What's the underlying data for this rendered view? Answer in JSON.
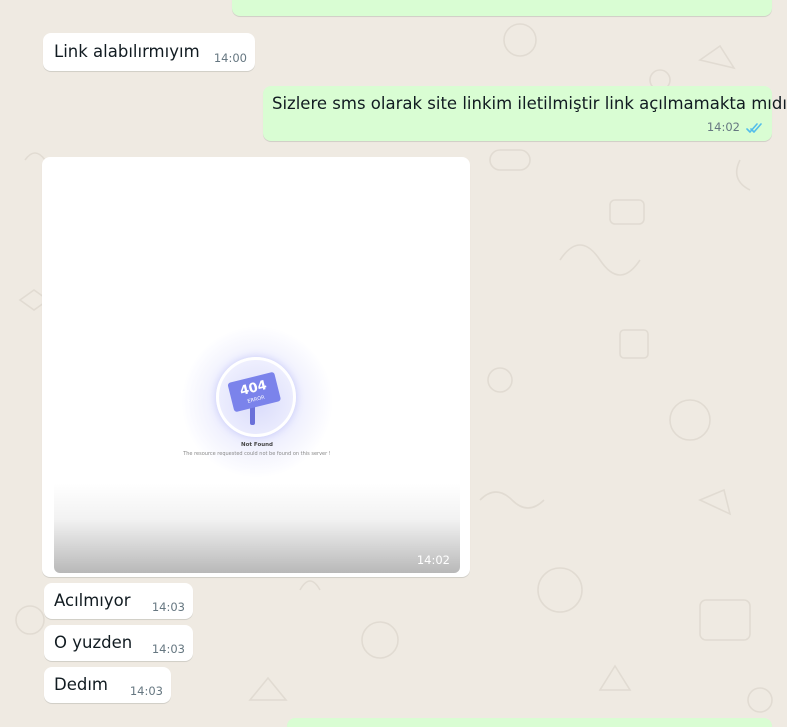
{
  "messages": [
    {
      "direction": "in",
      "text": "Link alabılırmıyım",
      "time": "14:00"
    },
    {
      "direction": "out",
      "text": "Sizlere sms olarak site linkim iletilmiştir link açılmamakta mıdır",
      "time": "14:02",
      "status": "read"
    },
    {
      "direction": "in",
      "type": "image",
      "time": "14:02",
      "image": {
        "badge_top": "404",
        "badge_bottom": "ERROR",
        "title": "Not Found",
        "subtitle": "The resource requested could not be found on this server !"
      }
    },
    {
      "direction": "in",
      "text": "Acılmıyor",
      "time": "14:03"
    },
    {
      "direction": "in",
      "text": "O yuzden",
      "time": "14:03"
    },
    {
      "direction": "in",
      "text": "Dedım",
      "time": "14:03"
    }
  ],
  "colors": {
    "chat_background": "#efeae2",
    "incoming_bubble": "#ffffff",
    "outgoing_bubble": "#d9fdd3",
    "read_ticks": "#53bdeb",
    "sign_blue": "#7b83eb"
  },
  "icons": {
    "read_status": "double-check-icon"
  }
}
